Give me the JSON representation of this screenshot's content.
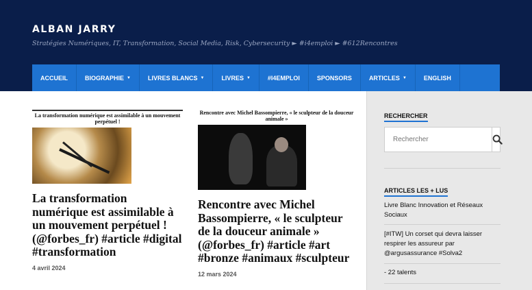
{
  "header": {
    "site_title": "ALBAN JARRY",
    "tagline": "Stratégies Numériques, IT, Transformation, Social Media, Risk, Cybersecurity ► #i4emploi ► #612Rencontres"
  },
  "nav": {
    "items": [
      {
        "label": "ACCUEIL"
      },
      {
        "label": "BIOGRAPHIE",
        "caret": "▼"
      },
      {
        "label": "LIVRES BLANCS",
        "caret": "▼"
      },
      {
        "label": "LIVRES",
        "caret": "▼"
      },
      {
        "label": "#I4EMPLOI"
      },
      {
        "label": "SPONSORS"
      },
      {
        "label": "ARTICLES",
        "caret": "▼"
      },
      {
        "label": "ENGLISH"
      }
    ]
  },
  "posts": [
    {
      "thumb_caption": "La transformation numérique est assimilable à un mouvement perpétuel !",
      "title": "La transformation numérique est assimilable à un mouvement perpétuel ! (@forbes_fr) #article #digital #transformation",
      "date": "4 avril 2024"
    },
    {
      "thumb_caption": "Rencontre avec Michel Bassompierre, « le sculpteur de la douceur animale »",
      "title": "Rencontre avec Michel Bassompierre, « le sculpteur de la douceur animale » (@forbes_fr) #article #art #bronze #animaux #sculpteur",
      "date": "12 mars 2024"
    }
  ],
  "sidebar": {
    "search": {
      "title": "RECHERCHER",
      "placeholder": "Rechercher",
      "icon": "search-icon"
    },
    "popular": {
      "title": "ARTICLES LES + LUS",
      "items": [
        {
          "label": "Livre Blanc Innovation et Réseaux Sociaux"
        },
        {
          "label": "[#ITW] Un corset qui devra laisser respirer les assureur par @argusassurance #Solva2"
        },
        {
          "label": "- 22 talents"
        }
      ]
    }
  },
  "colors": {
    "header_bg": "#0a1e4a",
    "nav_bg": "#1e73d2",
    "accent": "#1e73d2"
  }
}
